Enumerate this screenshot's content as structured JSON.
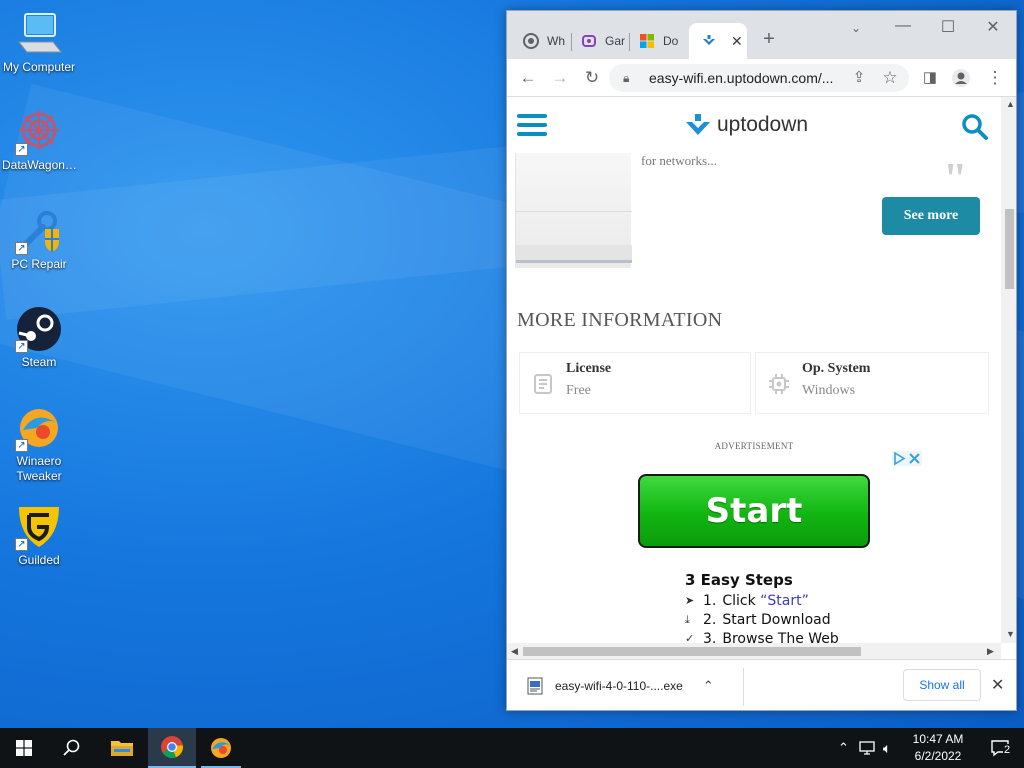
{
  "desktop": {
    "icons": [
      {
        "label": "My Computer",
        "icon": "computer-icon"
      },
      {
        "label": "DataWagon…",
        "icon": "datawagon-icon"
      },
      {
        "label": "PC Repair",
        "icon": "pc-repair-icon"
      },
      {
        "label": "Steam",
        "icon": "steam-icon"
      },
      {
        "label": "Winaero Tweaker",
        "icon": "winaero-tweaker-icon"
      },
      {
        "label": "Guilded",
        "icon": "guilded-icon"
      }
    ]
  },
  "browser": {
    "tabs": [
      {
        "label": "Wh",
        "icon": "chrome-icon"
      },
      {
        "label": "Gar",
        "icon": "phone-icon"
      },
      {
        "label": "Do",
        "icon": "microsoft-icon"
      },
      {
        "label": "",
        "icon": "uptodown-icon",
        "active": true
      }
    ],
    "url": "easy-wifi.en.uptodown.com/...",
    "colors": {
      "accent": "#1d8ba3",
      "link": "#1a73e8",
      "start_green": "#11b511"
    }
  },
  "page": {
    "logo_text": "uptodown",
    "review_snippet": "for networks...",
    "see_more": "See more",
    "more_info_title": "MORE INFORMATION",
    "info_cards": [
      {
        "title": "License",
        "value": "Free",
        "icon": "document-icon"
      },
      {
        "title": "Op. System",
        "value": "Windows",
        "icon": "chip-icon"
      }
    ],
    "advertisement_label": "ADVERTISEMENT",
    "ad": {
      "start_button": "Start",
      "steps_title": "3 Easy Steps",
      "steps": [
        {
          "num": "1.",
          "text": "Click ",
          "link": "“Start”",
          "icon": "cursor-icon"
        },
        {
          "num": "2.",
          "text": "Start Download",
          "link": "",
          "icon": "download-icon"
        },
        {
          "num": "3.",
          "text": "Browse The Web",
          "link": "",
          "icon": "check-circle-icon"
        }
      ]
    }
  },
  "download_bar": {
    "filename": "easy-wifi-4-0-110-....exe",
    "show_all": "Show all"
  },
  "taskbar": {
    "time": "10:47 AM",
    "date": "6/2/2022",
    "notification_count": "2"
  }
}
